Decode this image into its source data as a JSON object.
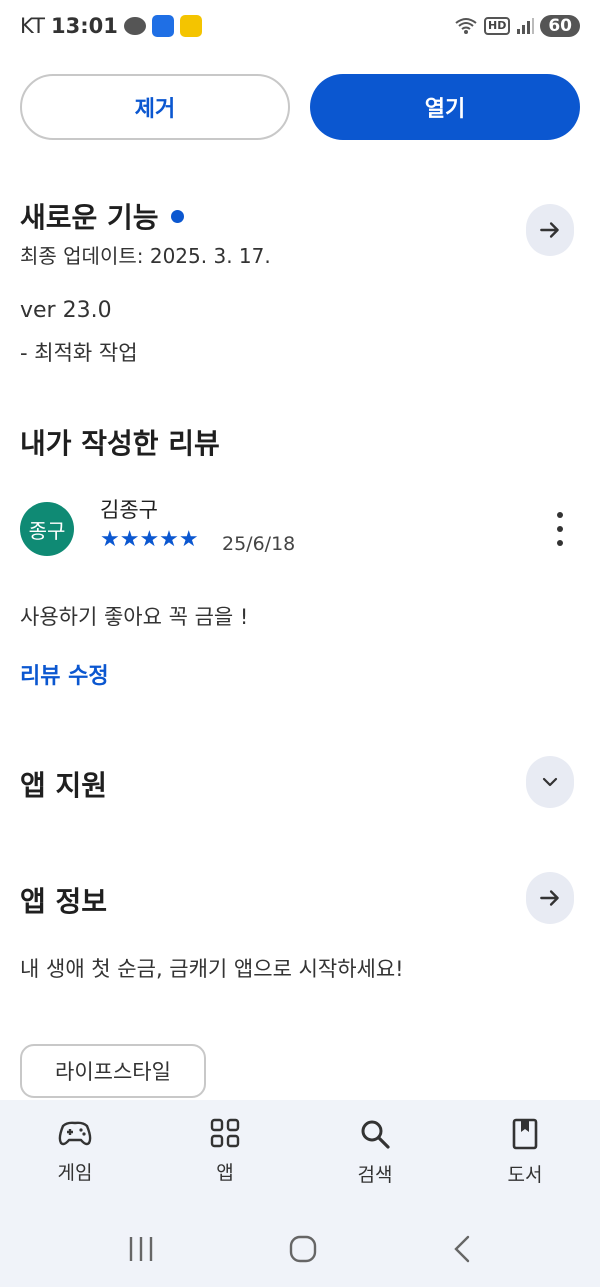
{
  "status_bar": {
    "carrier": "KT",
    "time": "13:01",
    "hd_label": "HD",
    "battery": "60"
  },
  "actions": {
    "remove_label": "제거",
    "open_label": "열기"
  },
  "whats_new": {
    "title": "새로운 기능",
    "last_updated": "최종 업데이트: 2025. 3. 17.",
    "version": "ver 23.0",
    "notes": "- 최적화 작업"
  },
  "my_review": {
    "title": "내가 작성한 리뷰",
    "avatar_text": "종구",
    "reviewer_name": "김종구",
    "rating": 5,
    "stars": "★★★★★",
    "date": "25/6/18",
    "body": "사용하기 좋아요 꼭 금을 !",
    "edit_link": "리뷰 수정"
  },
  "app_support": {
    "title": "앱 지원"
  },
  "app_info": {
    "title": "앱 정보",
    "description": "내 생애 첫 순금, 금캐기 앱으로 시작하세요!",
    "category_chip": "라이프스타일"
  },
  "bottom_nav": {
    "items": [
      {
        "label": "게임",
        "icon": "gamepad-icon"
      },
      {
        "label": "앱",
        "icon": "apps-grid-icon"
      },
      {
        "label": "검색",
        "icon": "search-icon"
      },
      {
        "label": "도서",
        "icon": "book-icon"
      }
    ]
  },
  "colors": {
    "accent": "#0b57d0",
    "avatar_bg": "#0f8a74",
    "nav_bg": "#f0f3f9"
  }
}
